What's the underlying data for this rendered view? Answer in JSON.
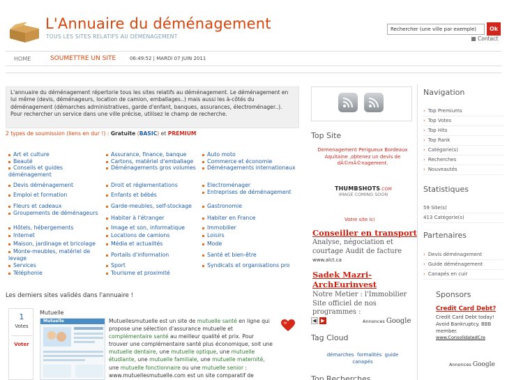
{
  "header": {
    "title": "L'Annuaire du déménagement",
    "subtitle": "TOUS LES SITES RELATIFS AU DÉMÉNAGEMENT",
    "search_placeholder": "Rechercher (une ville par exemple)",
    "search_button": "Ok",
    "contact": "Contact",
    "logo_icon": "cardboard-box-icon"
  },
  "nav": {
    "home": "HOME",
    "submit": "SOUMETTRE UN SITE",
    "datetime": "06:49:52 | MARDI 07 JUIN 2011"
  },
  "intro": {
    "text": "L'annuaire du déménagement répertorie tous les sites relatifs au déménagement. Le déménagement en lui même (devis, déménageurs, location de camion, emballages..) mais aussi les à-côtés du déménagement (démarches administratives, garde d'enfant, banques, assurances, électroménager..). Pour rechercher un service dans une ville précise, utilisez le champ de recherche.",
    "types_prefix": "2 types de soumission (liens en dur !) : ",
    "types_gratuite": "Gratuite",
    "types_basic": "BASIC",
    "types_et": "et",
    "types_premium": "PREMIUM"
  },
  "categories": {
    "col1": [
      "Art et culture",
      "Beauté",
      "Conseils et guides déménagement",
      "Devis déménagement",
      "Emploi et formation",
      "Fleurs et cadeaux",
      "Groupements de déménageurs",
      "Hôtels, hébergements",
      "Internet",
      "Maison, jardinage et bricolage",
      "Monte-meubles, matériel de levage",
      "Services",
      "Téléphonie"
    ],
    "col2": [
      "Assurance, finance, banque",
      "Cartons, matériel d'emballage",
      "Déménagements gros volumes",
      "Droit et réglementations",
      "Enfants et bébés",
      "Garde-meubles, self-stockage",
      "Habiter à l'étranger",
      "Image et son, informatique",
      "Locations de camions",
      "Média et actualités",
      "Portails d'information",
      "Sport",
      "Tourisme et proximité"
    ],
    "col3": [
      "Auto moto",
      "Commerce et économie",
      "Déménagements internationaux",
      "Electroménager",
      "Entreprises de déménagement",
      "Gastronomie",
      "Habiter en France",
      "Immobilier",
      "Loisirs",
      "Mode",
      "Santé et bien-être",
      "Syndicats et organisations pro"
    ]
  },
  "latest": {
    "heading": "Les derniers sites validés dans l'annuaire !",
    "votes_count": "1",
    "votes_label": "Votes",
    "vote_button": "Voter",
    "site_title": "Mutuelle",
    "thumb_label": "Mutuelle",
    "desc_parts": [
      {
        "t": "Mutuellesmutuelle est un site de ",
        "h": false
      },
      {
        "t": "mutuelle santé",
        "h": true
      },
      {
        "t": " en ligne qui propose une sélection d'assurance mutuelle et ",
        "h": false
      },
      {
        "t": "complémentaire santé",
        "h": true
      },
      {
        "t": " au meilleur qualité et prix. Pour trouver une complémentaire santé plus économique, soit une ",
        "h": false
      },
      {
        "t": "mutuelle dentaire",
        "h": true
      },
      {
        "t": ", une ",
        "h": false
      },
      {
        "t": "mutuelle optique",
        "h": true
      },
      {
        "t": ", une ",
        "h": false
      },
      {
        "t": "mutuelle étudiante",
        "h": true
      },
      {
        "t": ", une ",
        "h": false
      },
      {
        "t": "mutuelle familiale",
        "h": true
      },
      {
        "t": ", une ",
        "h": false
      },
      {
        "t": "mutuelle maternité",
        "h": true
      },
      {
        "t": ", une ",
        "h": false
      },
      {
        "t": "mutuelle fonctionnaire",
        "h": true
      },
      {
        "t": " ou une ",
        "h": false
      },
      {
        "t": "mutuelle senior",
        "h": true
      },
      {
        "t": " : www.mutuellesmutuelle.com est un site comparatif de ",
        "h": false
      },
      {
        "t": "mutuelle",
        "h": true
      },
      {
        "t": " gratuit,",
        "h": false
      }
    ]
  },
  "middle": {
    "top_site_heading": "Top Site",
    "top_site_desc": "Demenagement Perigueux Bordeaux Aquitaine ,obtenez un devis de dÃ©mÃ©nagement.",
    "thumbshots_logo": "THUMBSHOTS",
    "thumbshots_com": ".COM",
    "thumbshots_sub": "IMAGE COMING SOON",
    "votre_site": "Votre site ici",
    "ads": [
      {
        "title": "Conseiller en transport",
        "text": "Analyse, négociation et courtage Audit de facture",
        "url": "www.alct.ca"
      },
      {
        "title": "Sadek Mazri-ArchEurinvest",
        "text": "Notre Metier : l'Immobilier Site officiel de nos programmes :",
        "url": ""
      }
    ],
    "annonces": "Annonces",
    "google": "Google",
    "tag_cloud_heading": "Tag Cloud",
    "tags": [
      "démarches",
      "formalités",
      "guide",
      "canapés"
    ],
    "top_recherches_heading": "Top Recherches"
  },
  "right": {
    "navigation_heading": "Navigation",
    "navigation": [
      "Top Premiums",
      "Top Votes",
      "Top Hits",
      "Top Rank",
      "Catégorie(s)",
      "Recherches",
      "Nouveautés"
    ],
    "stats_heading": "Statistiques",
    "stats": [
      "59 Site(s)",
      "413 Catégorie(s)"
    ],
    "partners_heading": "Partenaires",
    "partners": [
      "Devis déménagement",
      "Guide déménagement",
      "Canapés en cuir"
    ],
    "sponsors_heading": "Sponsors",
    "sponsor_ad": {
      "title": "Credit Card Debt?",
      "text": "Credit Card Debt today! Avoid Bankruptcy. BBB member.",
      "url": "www.ConsolidatedCre"
    },
    "annonces": "Annonces",
    "google": "Google"
  },
  "colors": {
    "accent": "#d8430a",
    "link": "#1e5ca8",
    "red": "#d0261c"
  }
}
